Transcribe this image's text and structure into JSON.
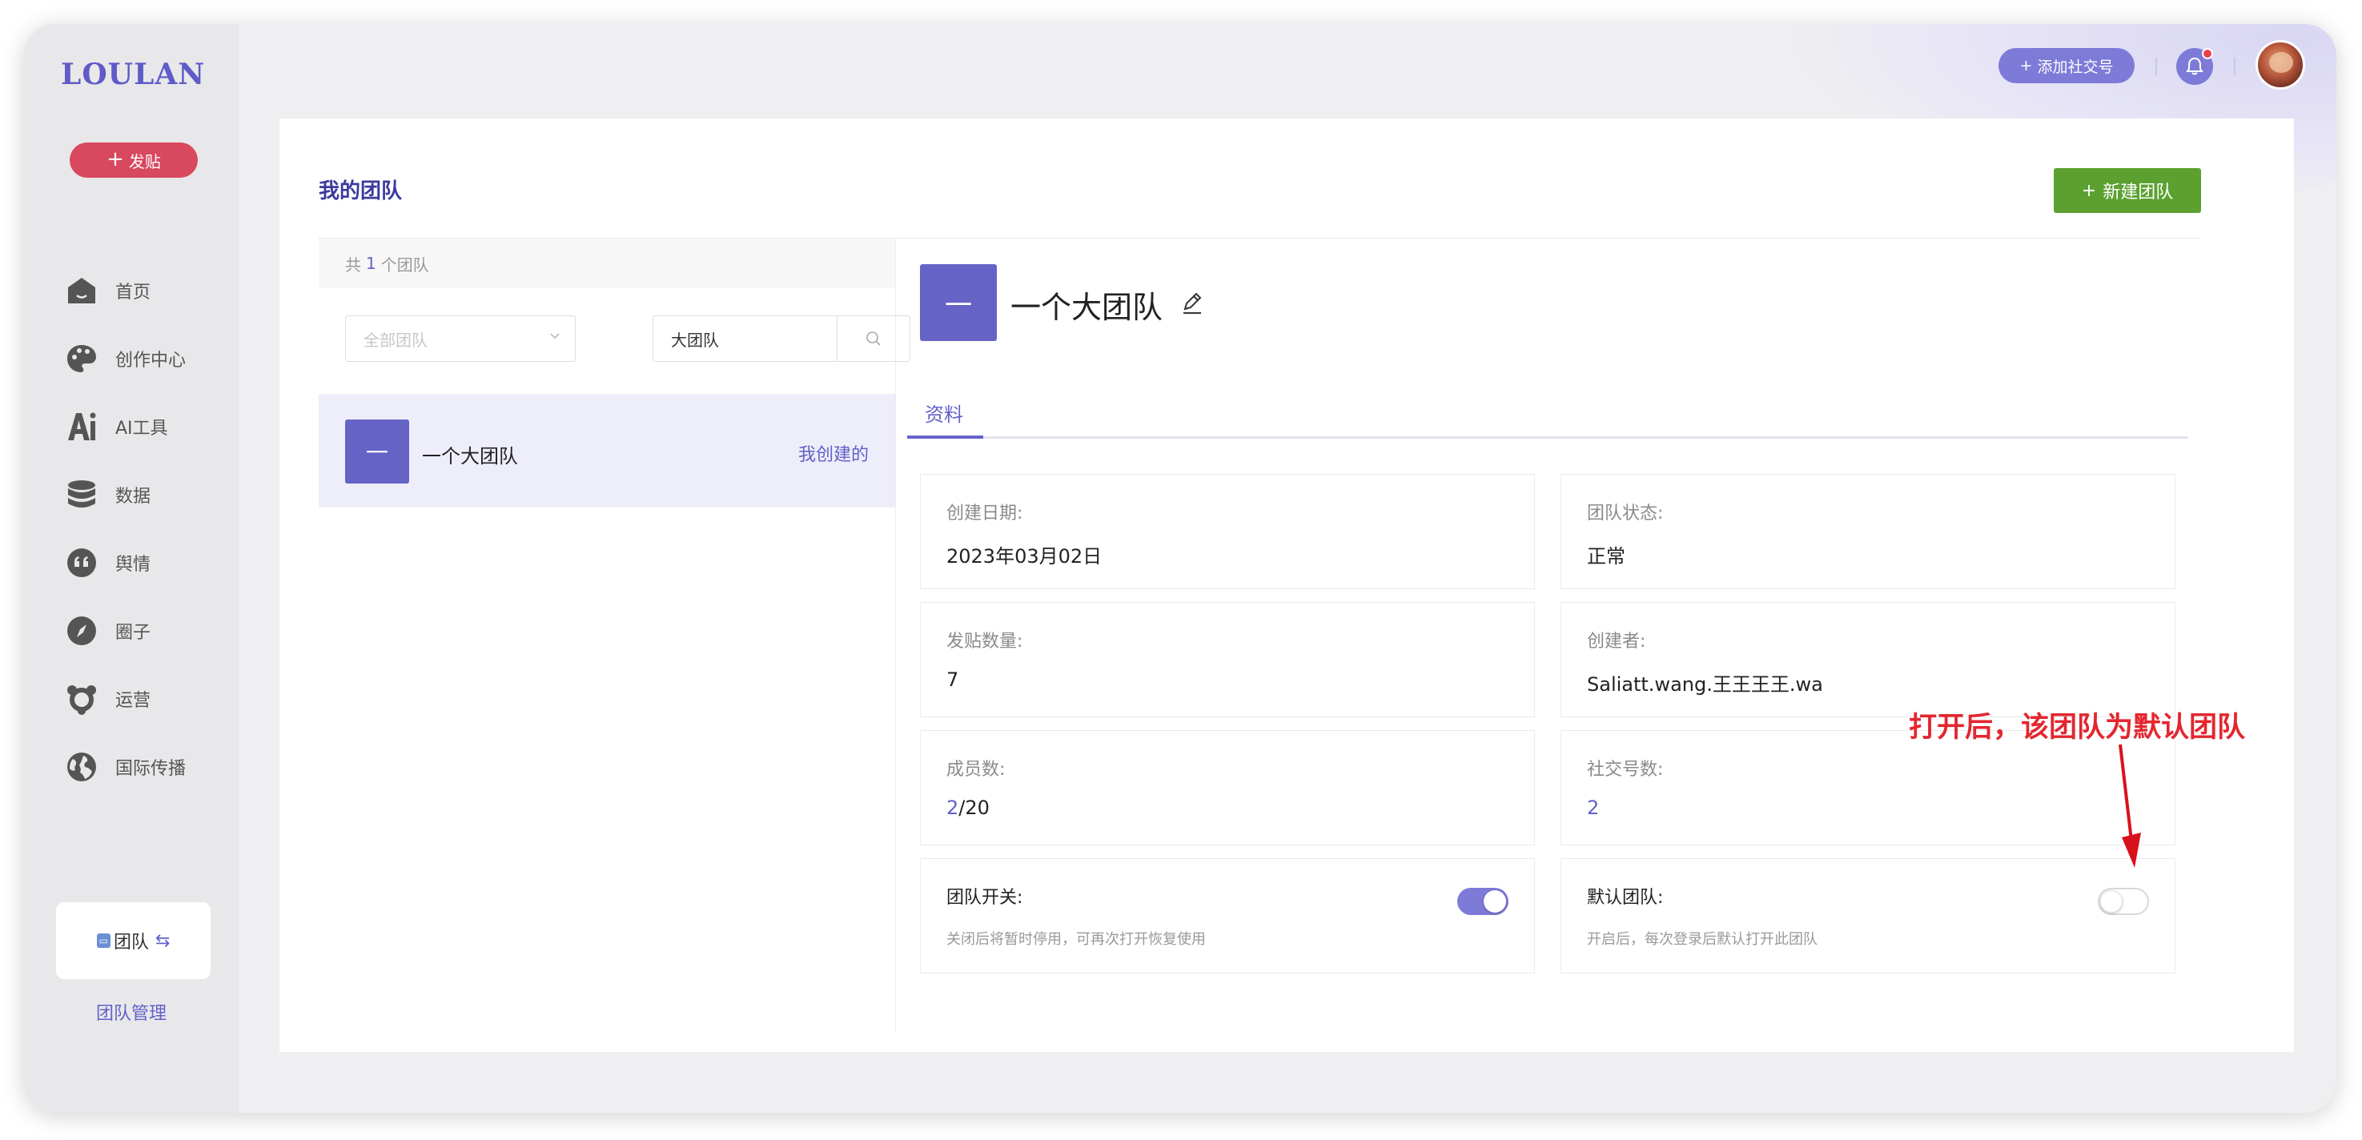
{
  "brand": {
    "logo": "LOULAN",
    "accent": "#6663c6",
    "post_color": "#d8485f",
    "new_team_color": "#5ca130"
  },
  "sidebar": {
    "post_button": {
      "plus": "+",
      "label": "发贴"
    },
    "items": [
      {
        "label": "首页",
        "icon": "home-icon"
      },
      {
        "label": "创作中心",
        "icon": "palette-icon"
      },
      {
        "label": "AI工具",
        "icon": "ai-icon"
      },
      {
        "label": "数据",
        "icon": "database-icon"
      },
      {
        "label": "舆情",
        "icon": "quote-icon"
      },
      {
        "label": "圈子",
        "icon": "compass-icon"
      },
      {
        "label": "运营",
        "icon": "operations-icon"
      },
      {
        "label": "国际传播",
        "icon": "globe-icon"
      }
    ],
    "team_switch": {
      "label": "团队",
      "swap": "⇆"
    },
    "team_manage": "团队管理"
  },
  "header": {
    "add_social": {
      "plus": "+",
      "label": "添加社交号"
    }
  },
  "page": {
    "title": "我的团队",
    "new_team": {
      "plus": "+",
      "label": "新建团队"
    }
  },
  "team_list": {
    "count_prefix": "共",
    "count": "1",
    "count_suffix": "个团队",
    "filter_placeholder": "全部团队",
    "search_value": "大团队",
    "items": [
      {
        "avatar": "一",
        "name": "一个大团队",
        "role": "我创建的"
      }
    ]
  },
  "detail": {
    "avatar": "一",
    "title": "一个大团队",
    "tab": "资料",
    "fields": {
      "created": {
        "label": "创建日期:",
        "value": "2023年03月02日"
      },
      "status": {
        "label": "团队状态:",
        "value": "正常"
      },
      "posts": {
        "label": "发贴数量:",
        "value": "7"
      },
      "creator": {
        "label": "创建者:",
        "value": "Saliatt.wang.王王王王.wa"
      },
      "members": {
        "label": "成员数:",
        "current": "2",
        "max": "/20"
      },
      "social": {
        "label": "社交号数:",
        "value": "2"
      },
      "team_switch": {
        "label": "团队开关:",
        "hint": "关闭后将暂时停用，可再次打开恢复使用",
        "on": true
      },
      "default_team": {
        "label": "默认团队:",
        "hint": "开启后，每次登录后默认打开此团队",
        "on": false
      }
    }
  },
  "annotation": {
    "text": "打开后，该团队为默认团队",
    "color": "#e3262f"
  }
}
